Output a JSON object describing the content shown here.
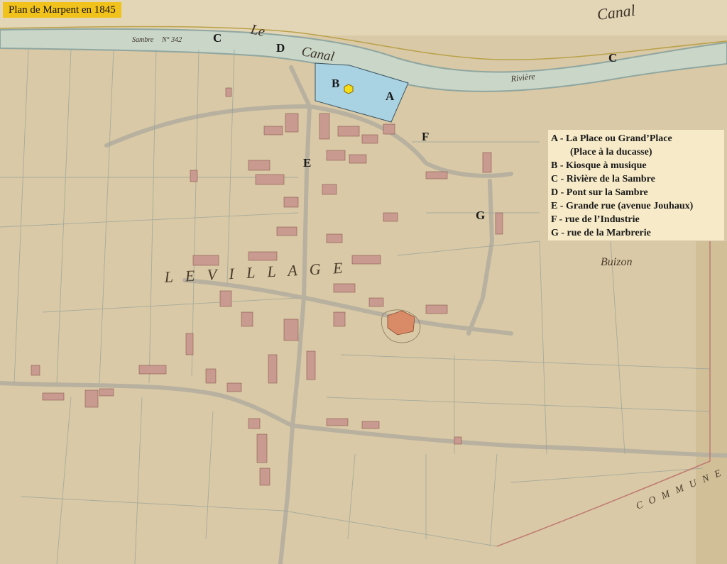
{
  "title": "Plan de Marpent en 1845",
  "colors": {
    "paper": "#d9c9a6",
    "river": "#c9d6c8",
    "river_edge": "#8fa6a0",
    "place_fill": "#a9d3e3",
    "buildings": "#c99a8f",
    "church": "#d98a66",
    "kiosk_marker": "#f7dd16",
    "title_bg": "#f2c21c",
    "legend_bg": "#f6eac8"
  },
  "markers": {
    "A": "A",
    "B": "B",
    "C1": "C",
    "C2": "C",
    "D": "D",
    "E": "E",
    "F": "F",
    "G": "G"
  },
  "legend": {
    "items": [
      "A - La Place ou Grand’Place",
      "(Place à la ducasse)",
      "B - Kiosque à musique",
      "C - Rivière de la Sambre",
      "D - Pont sur la Sambre",
      "E - Grande rue (avenue Jouhaux)",
      "F - rue de l’Industrie",
      "G - rue de la Marbrerie"
    ]
  },
  "map_text": {
    "canal_left": "Le",
    "canal_mid": "Canal",
    "canal_right": "Canal",
    "riviere": "Rivière",
    "sambre_label": "Sambre",
    "sambre_no": "N° 342",
    "village": "L E   V I L L A G E",
    "buizon": "Buizon",
    "commune": "C O M M U N E"
  }
}
